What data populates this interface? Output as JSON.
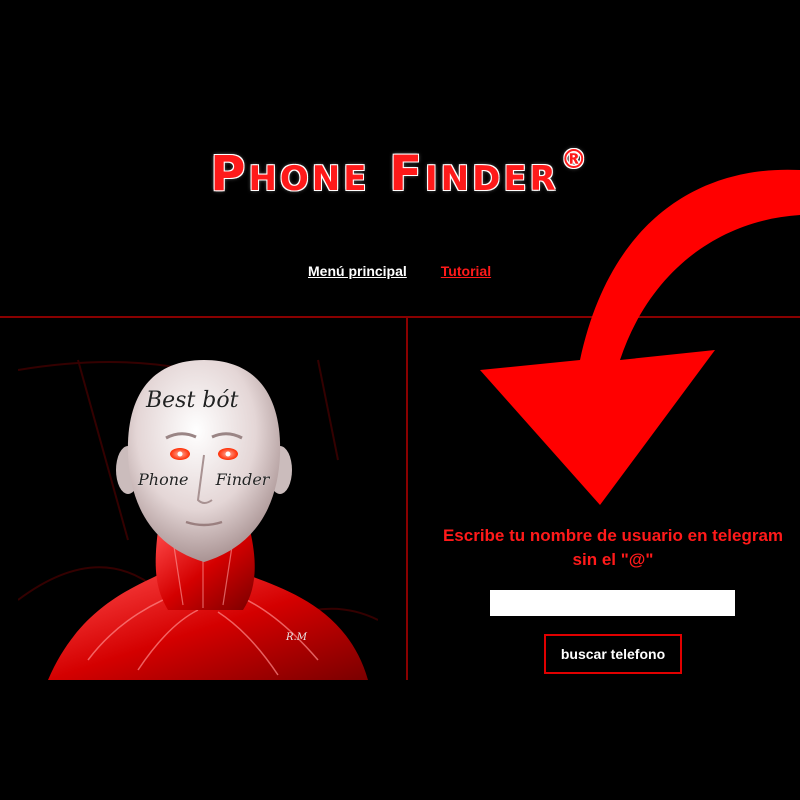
{
  "header": {
    "logo_text": "Phone Finder",
    "logo_mark": "®"
  },
  "nav": {
    "home_label": "Menú principal",
    "tutorial_label": "Tutorial"
  },
  "artwork": {
    "tattoo_top": "Best bót",
    "tattoo_mid": "Phone Finder",
    "signature": "R.M"
  },
  "form": {
    "prompt": "Escribe tu nombre de usuario en telegram sin el \"@\"",
    "username_value": "",
    "search_label": "buscar telefono"
  },
  "icons": {
    "arrow": "curved-arrow-down-icon"
  },
  "colors": {
    "background": "#000000",
    "accent_red": "#ff1a1a",
    "divider": "#8a0000",
    "link_white": "#ffffff"
  }
}
